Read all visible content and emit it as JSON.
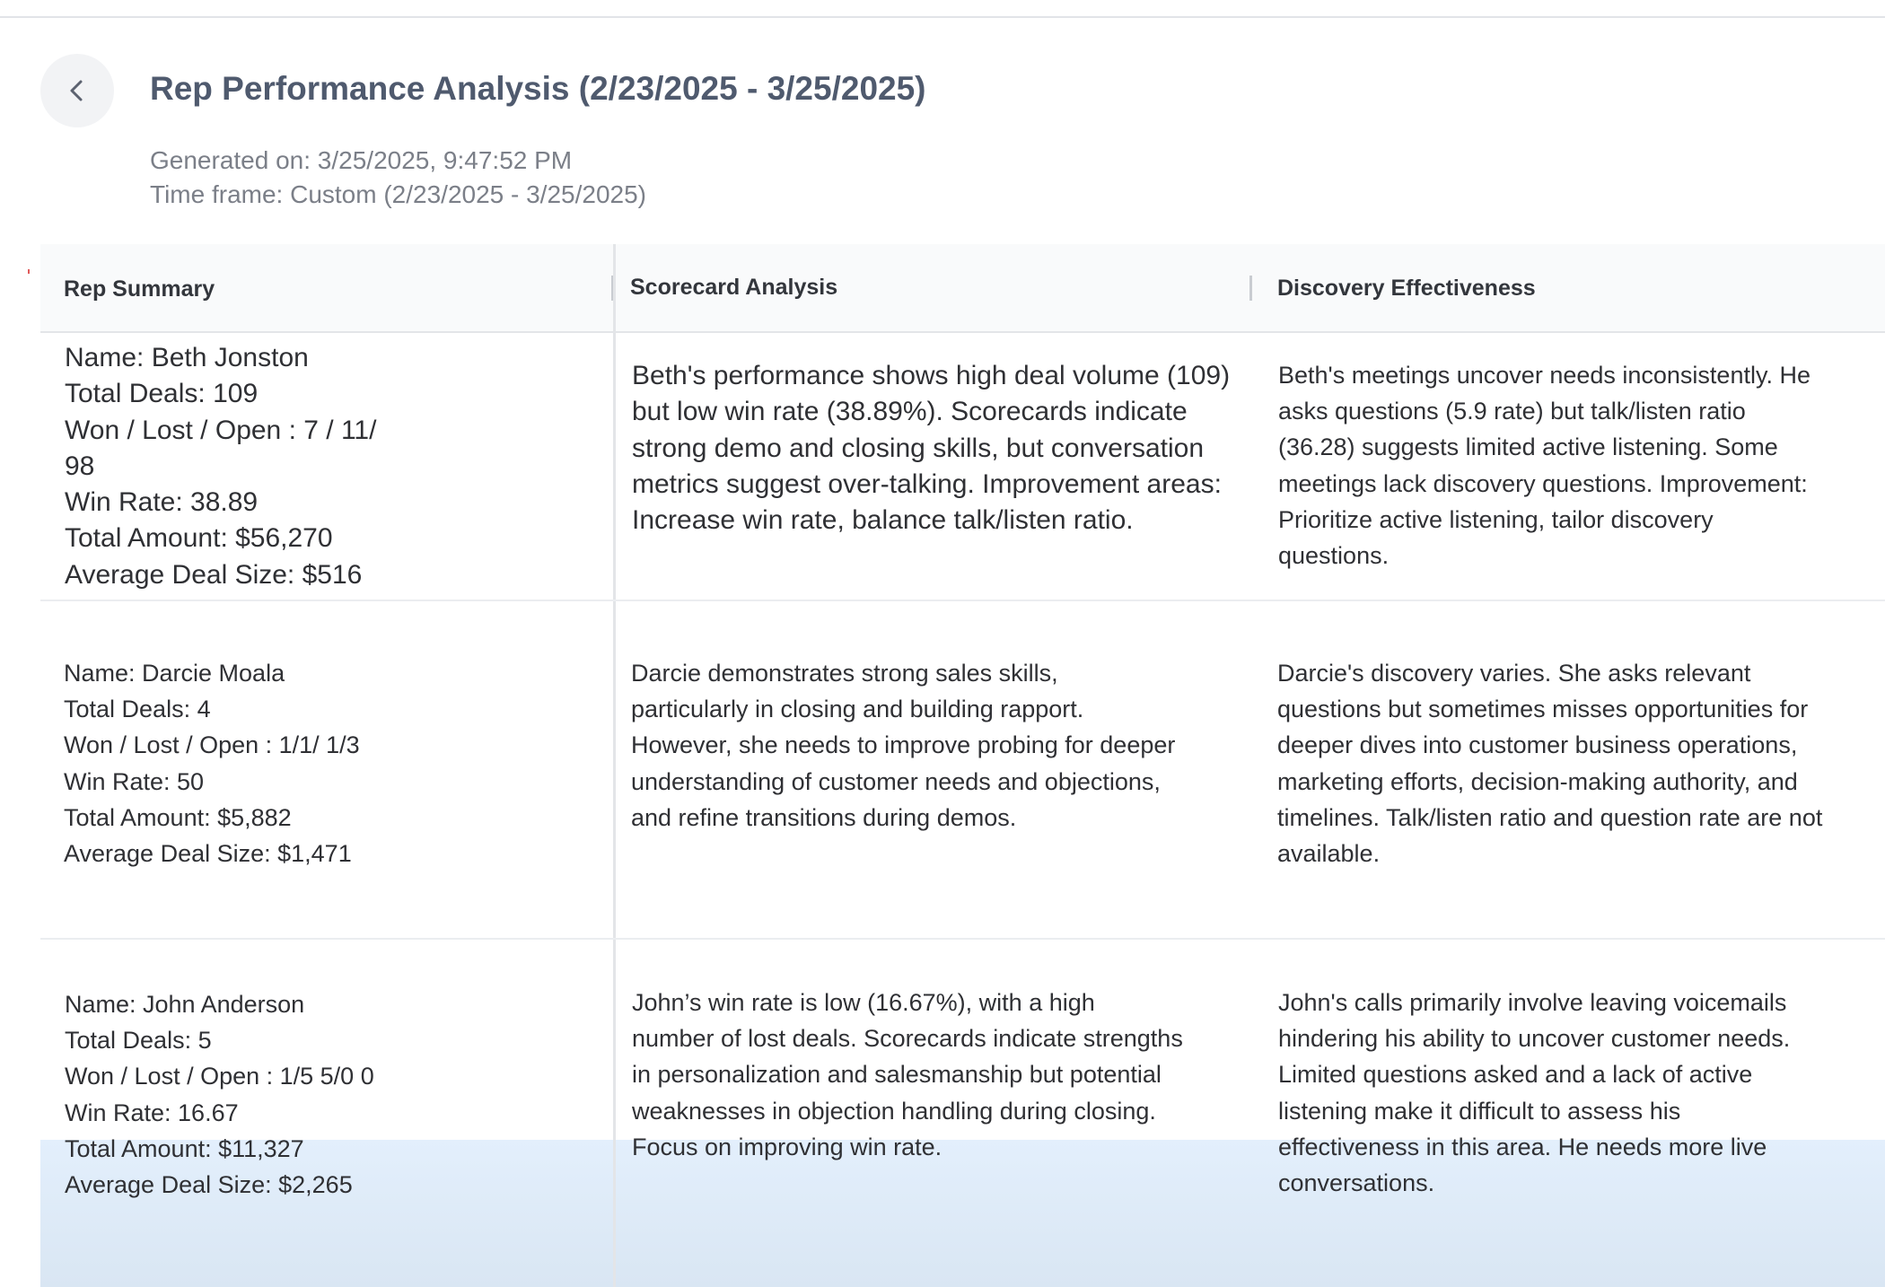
{
  "header": {
    "title": "Rep Performance Analysis (2/23/2025 - 3/25/2025)",
    "generated_on": "Generated on: 3/25/2025, 9:47:52 PM",
    "time_frame": "Time frame: Custom (2/23/2025 - 3/25/2025)",
    "back_icon": "chevron-left-icon"
  },
  "table": {
    "columns": [
      "Rep Summary",
      "Scorecard Analysis",
      "Discovery Effectiveness"
    ],
    "rows": [
      {
        "summary": [
          "Name: Beth Jonston",
          "Total Deals: 109",
          " Won / Lost / Open : 7 / 11/",
          "98",
          "Win Rate: 38.89",
          "Total Amount: $56,270",
          "Average Deal Size: $516"
        ],
        "scorecard": [
          "Beth's performance shows high deal volume (109)",
          "but low win rate (38.89%). Scorecards indicate",
          "strong demo and closing skills, but conversation",
          "metrics suggest over-talking. Improvement areas:",
          "Increase win rate, balance talk/listen ratio."
        ],
        "discovery": [
          "Beth's meetings uncover needs inconsistently. He",
          "asks questions (5.9 rate) but talk/listen ratio",
          "(36.28) suggests limited active listening. Some",
          "meetings lack discovery questions. Improvement:",
          "Prioritize active listening, tailor discovery",
          "questions."
        ]
      },
      {
        "summary": [
          "Name: Darcie Moala",
          " Total Deals: 4",
          " Won / Lost / Open : 1/1/ 1/3",
          " Win Rate: 50",
          "Total Amount: $5,882",
          "Average Deal Size: $1,471"
        ],
        "scorecard": [
          "Darcie demonstrates strong sales skills,",
          "particularly in closing and building rapport.",
          "However, she needs to improve probing for deeper",
          "understanding of customer needs and objections,",
          "and refine transitions during demos."
        ],
        "discovery": [
          "Darcie's discovery varies. She asks relevant",
          "questions but sometimes misses opportunities for",
          "deeper dives into customer business operations,",
          " marketing efforts, decision-making authority, and",
          "timelines. Talk/listen ratio and question rate are not",
          " available."
        ]
      },
      {
        "summary": [
          "Name: John Anderson",
          "Total Deals: 5",
          " Won / Lost / Open : 1/5 5/0 0",
          " Win Rate: 16.67",
          "Total Amount: $11,327",
          "Average Deal Size: $2,265"
        ],
        "scorecard": [
          "John’s win rate is low (16.67%), with a high",
          "number of lost deals. Scorecards indicate strengths",
          " in personalization and salesmanship but potential",
          "weaknesses in objection handling during closing.",
          "Focus on improving win rate."
        ],
        "discovery": [
          "John's calls primarily involve leaving voicemails",
          "hindering his ability to uncover customer needs.",
          "Limited questions asked and a lack of active",
          "listening make it difficult to assess his",
          "effectiveness in this area. He needs more live",
          "conversations."
        ]
      }
    ]
  },
  "colors": {
    "title": "#4f5a6e",
    "meta": "#7b7f88",
    "header_bg": "#f9fafb",
    "highlight": "#e3effc"
  }
}
